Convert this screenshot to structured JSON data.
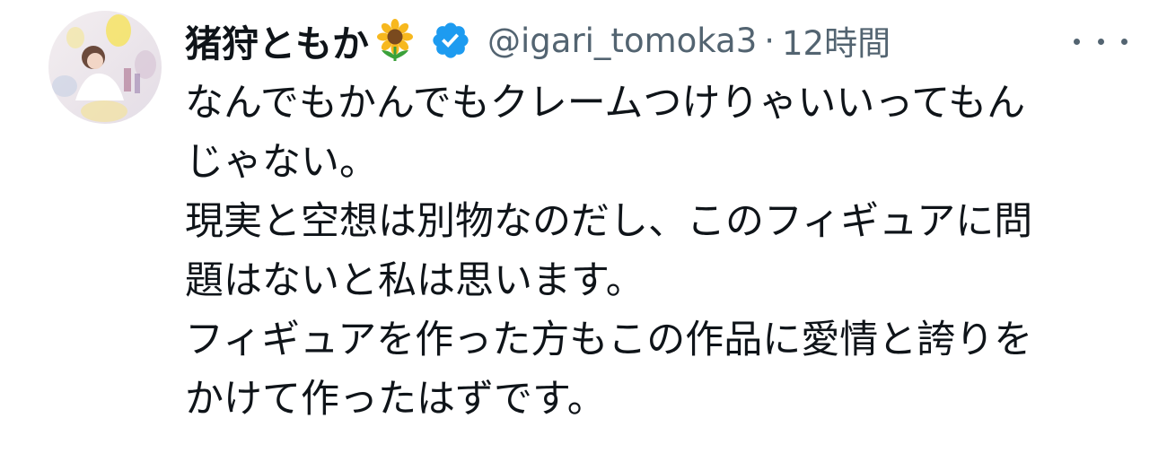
{
  "tweet": {
    "display_name": "猪狩ともか",
    "name_emoji_icon": "sunflower-icon",
    "verified_icon": "verified-badge-icon",
    "handle": "@igari_tomoka3",
    "separator": "·",
    "time": "12時間",
    "more_icon": "more-horizontal-icon",
    "text_lines": [
      "なんでもかんでもクレームつけりゃいいってもん",
      "じゃない。",
      "現実と空想は別物なのだし、このフィギュアに問",
      "題はないと私は思います。",
      "フィギュアを作った方もこの作品に愛情と誇りを",
      "かけて作ったはずです。"
    ]
  },
  "colors": {
    "text_primary": "#0f1419",
    "text_secondary": "#536471",
    "verified_blue": "#1d9bf0",
    "background": "#ffffff"
  }
}
